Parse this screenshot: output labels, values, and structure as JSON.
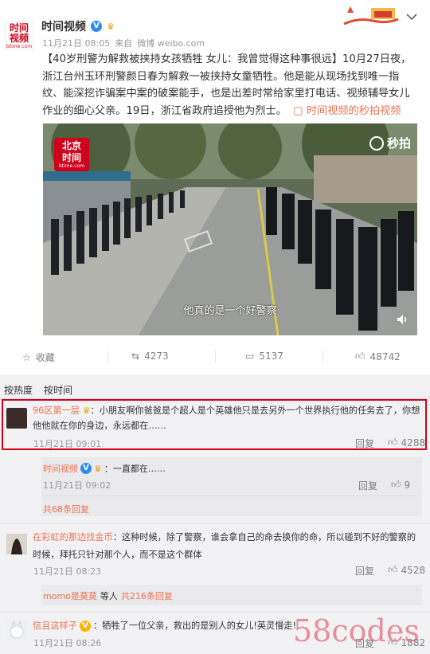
{
  "post": {
    "author": "时间视频",
    "avatar_text": "时间视频",
    "avatar_domain": "btime.com",
    "time": "11月21日 08:05",
    "source_prefix": "来自",
    "source": "微博 weibo.com",
    "text_head": "【40岁刑警为解救被挟持女孩牺牲 女儿：我曾觉得这种事很远】",
    "text_body": "10月27日夜，浙江台州玉环刑警颜日春为解救一被挟持女童牺牲。他是能从现场找到唯一指纹、能深挖诈骗案中案的破案能手，也是出差时常给家里打电话、视频辅导女儿作业的细心父亲。19日，浙江省政府追授他为烈士。",
    "video_link": "时间视频的秒拍视频",
    "video": {
      "logo_top": "北京",
      "logo_bottom": "时间",
      "logo_domain": "btime.com",
      "watermark": "秒拍",
      "subtitle": "他真的是一个好警察"
    }
  },
  "actions": {
    "favorite": "收藏",
    "repost": "4273",
    "comments": "5137",
    "likes": "48742"
  },
  "sort": {
    "hot": "按热度",
    "time": "按时间"
  },
  "comments": [
    {
      "user": "96区第一层",
      "text": "：小朋友啊你爸爸是个超人是个英雄他只是去另外一个世界执行他的任务去了，你想他他就在你的身边，永远都在……",
      "time": "11月21日 09:01",
      "reply": "回复",
      "likes": "4288",
      "sub": {
        "user": "时间视频",
        "text": "：一直都在……",
        "time": "11月21日 09:02",
        "reply": "回复",
        "likes": "9"
      },
      "more": "共68条回复"
    },
    {
      "user": "在彩虹的那边找金币",
      "text": "：这种时候，除了警察，谁会拿自己的命去换你的命，所以碰到不好的警察的时候，拜托只针对那个人，而不是这个群体",
      "time": "11月21日 08:23",
      "reply": "回复",
      "likes": "4528",
      "sub_summary_user": "momo是莫莫",
      "sub_summary_mid": "等人",
      "sub_summary_count": "共216条回复"
    },
    {
      "user": "信且这样子",
      "text": "：牺牲了一位父亲，救出的是别人的女儿!英灵慢走!",
      "time": "11月21日 08:26",
      "reply": "回复",
      "likes": "1882"
    }
  ],
  "watermark": "58codes"
}
